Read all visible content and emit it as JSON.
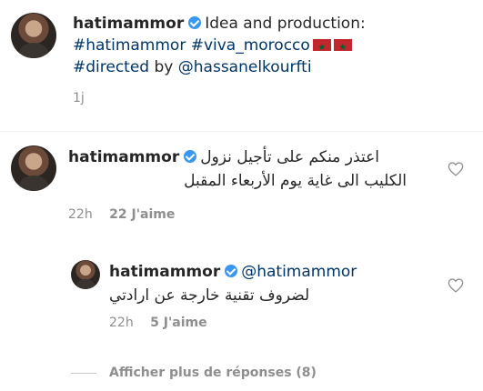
{
  "post": {
    "username": "hatimammor",
    "caption_intro": "Idea and production:",
    "hashtag_1": "#hatimammor",
    "hashtag_2": "#viva_morocco",
    "hashtag_3": "#directed",
    "caption_by": "by",
    "mention": "@hassanelkourfti",
    "time": "1j"
  },
  "comment_1": {
    "username": "hatimammor",
    "text_line_1": "اعتذر منكم على تأجيل نزول",
    "text_line_2": "الكليب الى غاية يوم الأربعاء المقبل",
    "time": "22h",
    "likes": "22 J'aime"
  },
  "reply_1": {
    "username": "hatimammor",
    "mention": "@hatimammor",
    "text": "لضروف تقنية خارجة عن ارادتي",
    "time": "22h",
    "likes": "5 J'aime"
  },
  "more_replies": {
    "label": "Afficher plus de réponses (8)"
  },
  "icons": {
    "verified": "verified-badge-icon",
    "heart": "heart-outline-icon",
    "flag": "morocco-flag-emoji"
  },
  "colors": {
    "text": "#262626",
    "muted": "#8e8e8e",
    "link": "#003569",
    "verified": "#3897f0"
  }
}
